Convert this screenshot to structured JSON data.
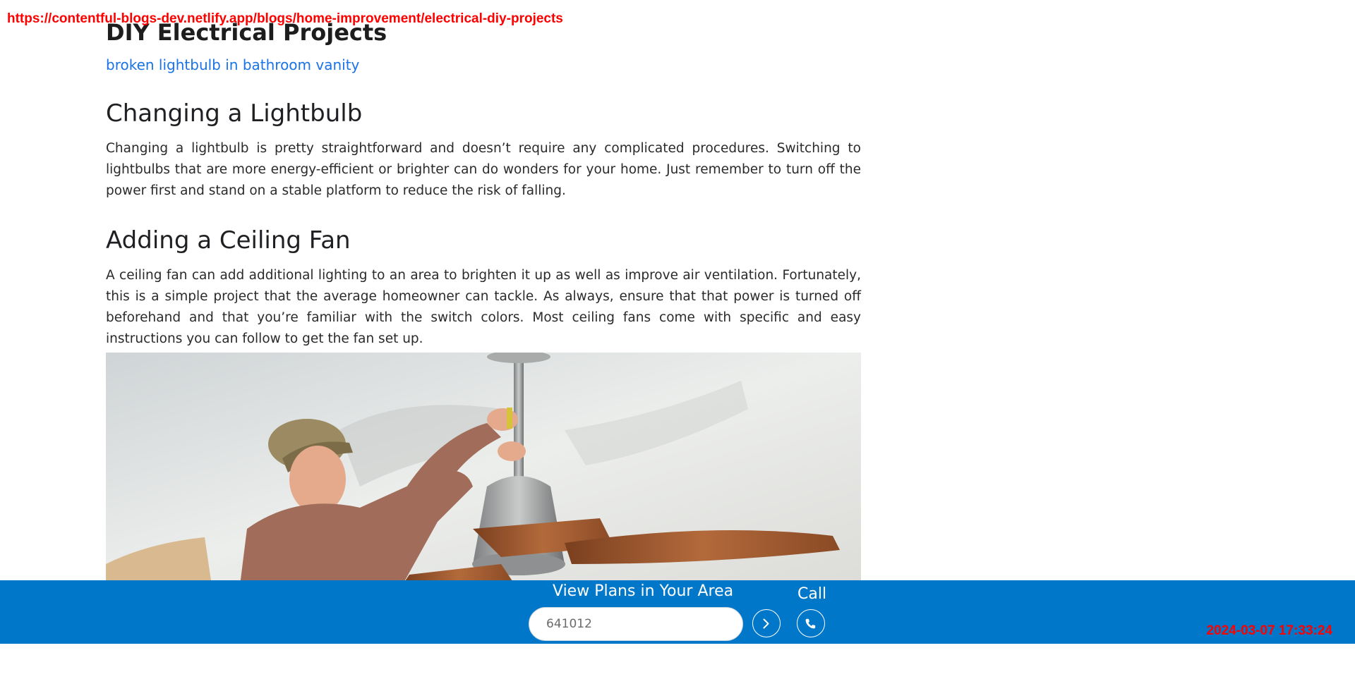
{
  "overlay": {
    "url": "https://contentful-blogs-dev.netlify.app/blogs/home-improvement/electrical-diy-projects",
    "timestamp": "2024-03-07 17:33:24"
  },
  "article": {
    "title": "DIY Electrical Projects",
    "image_alt_link": "broken lightbulb in bathroom vanity",
    "sections": [
      {
        "heading": "Changing a Lightbulb",
        "body": "Changing a lightbulb is pretty straightforward and doesn’t require any complicated procedures. Switching to lightbulbs that are more energy-efficient or brighter can do wonders for your home. Just remember to turn off the power first and stand on a stable platform to reduce the risk of falling."
      },
      {
        "heading": "Adding a Ceiling Fan",
        "body": "A ceiling fan can add additional lighting to an area to brighten it up as well as improve air ventilation. Fortunately, this is a simple project that the average homeowner can tackle. As always, ensure that that power is turned off beforehand and that you’re familiar with the switch colors. Most ceiling fans come with specific and easy instructions you can follow to get the fan set up."
      }
    ]
  },
  "bottom_bar": {
    "title": "View Plans in Your Area",
    "zip_value": "641012",
    "go_icon": "chevron-right-icon",
    "call_label": "Call",
    "call_icon": "phone-icon"
  },
  "colors": {
    "bar": "#0077c8",
    "link": "#1a73e8",
    "overlay": "#ff0000"
  }
}
